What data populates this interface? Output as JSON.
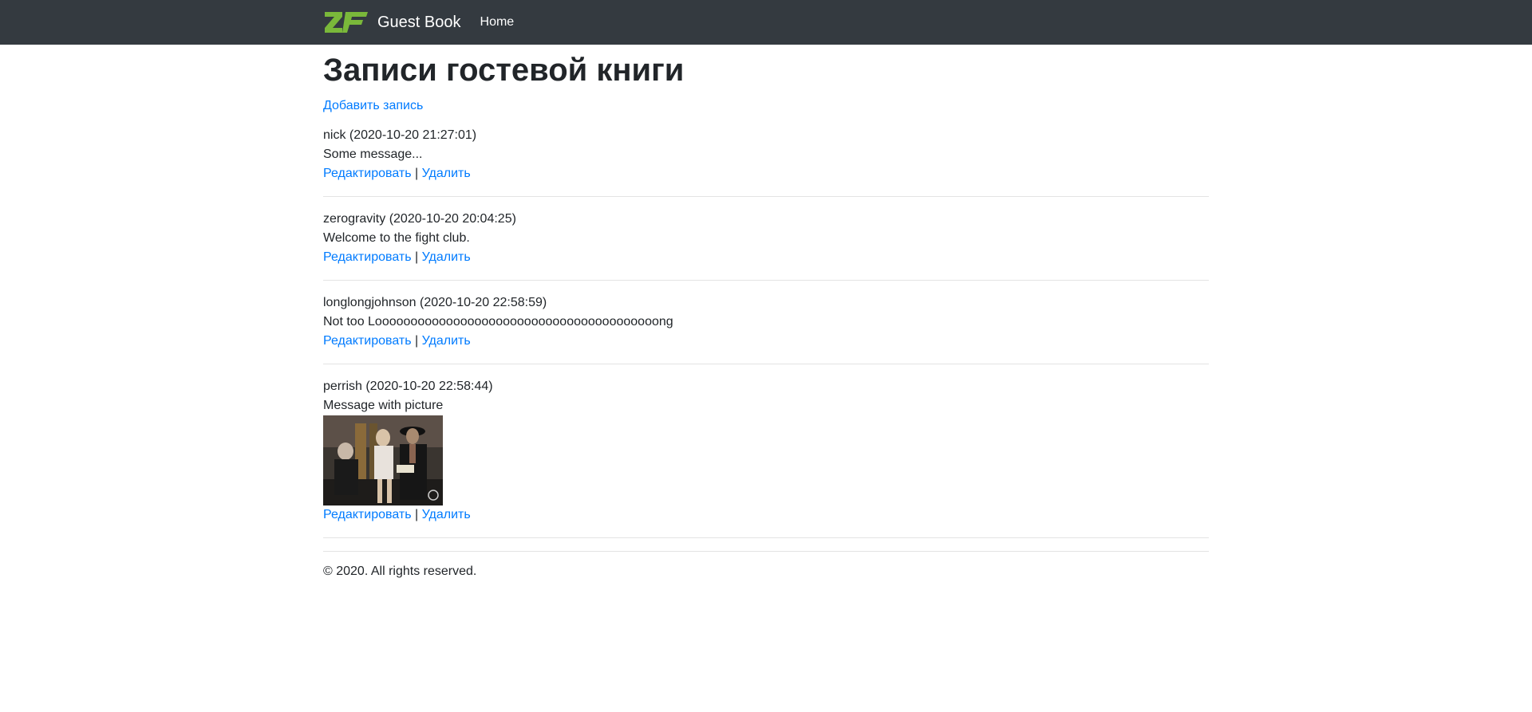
{
  "nav": {
    "brand": "Guest Book",
    "home": "Home",
    "logo_color": "#7ab83a"
  },
  "page": {
    "title": "Записи гостевой книги",
    "add_link": "Добавить запись"
  },
  "entries": [
    {
      "header": "nick (2020-10-20 21:27:01)",
      "message": "Some message...",
      "edit": "Редактировать",
      "sep": "|",
      "delete": "Удалить"
    },
    {
      "header": "zerogravity (2020-10-20 20:04:25)",
      "message": "Welcome to the fight club.",
      "edit": "Редактировать",
      "sep": "|",
      "delete": "Удалить"
    },
    {
      "header": "longlongjohnson (2020-10-20 22:58:59)",
      "message": "Not too Loooooooooooooooooooooooooooooooooooooooong",
      "edit": "Редактировать",
      "sep": "|",
      "delete": "Удалить"
    },
    {
      "header": "perrish (2020-10-20 22:58:44)",
      "message": "Message with picture",
      "edit": "Редактировать",
      "sep": "|",
      "delete": "Удалить"
    }
  ],
  "footer": {
    "text": "© 2020. All rights reserved."
  },
  "colors": {
    "navbar": "#343a40",
    "link": "#007bff",
    "text": "#212529"
  }
}
